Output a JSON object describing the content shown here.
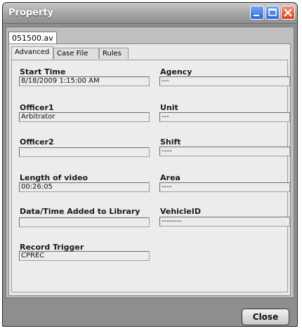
{
  "window": {
    "title": "Property"
  },
  "file_tab": {
    "label": "051500.av"
  },
  "tabs": [
    {
      "label": "Advanced",
      "active": true
    },
    {
      "label": "Case File",
      "active": false
    },
    {
      "label": "Rules",
      "active": false
    }
  ],
  "fields": {
    "start_time": {
      "label": "Start Time",
      "value": "8/18/2009 1:15:00 AM"
    },
    "agency": {
      "label": "Agency",
      "value": "---"
    },
    "officer1": {
      "label": "Officer1",
      "value": "Arbitrator"
    },
    "unit": {
      "label": "Unit",
      "value": "---"
    },
    "officer2": {
      "label": "Officer2",
      "value": ""
    },
    "shift": {
      "label": "Shift",
      "value": "----"
    },
    "length_of_video": {
      "label": "Length of video",
      "value": "00:26:05"
    },
    "area": {
      "label": "Area",
      "value": "----"
    },
    "date_added": {
      "label": "Data/Time Added to Library",
      "value": ""
    },
    "vehicle_id": {
      "label": "VehicleID",
      "value": "--------"
    },
    "record_trigger": {
      "label": "Record Trigger",
      "value": "CPREC"
    }
  },
  "footer": {
    "close_label": "Close"
  },
  "colors": {
    "title_min_max": "#2b66d8",
    "title_close": "#d2441f",
    "panel_bg": "#ececec"
  }
}
